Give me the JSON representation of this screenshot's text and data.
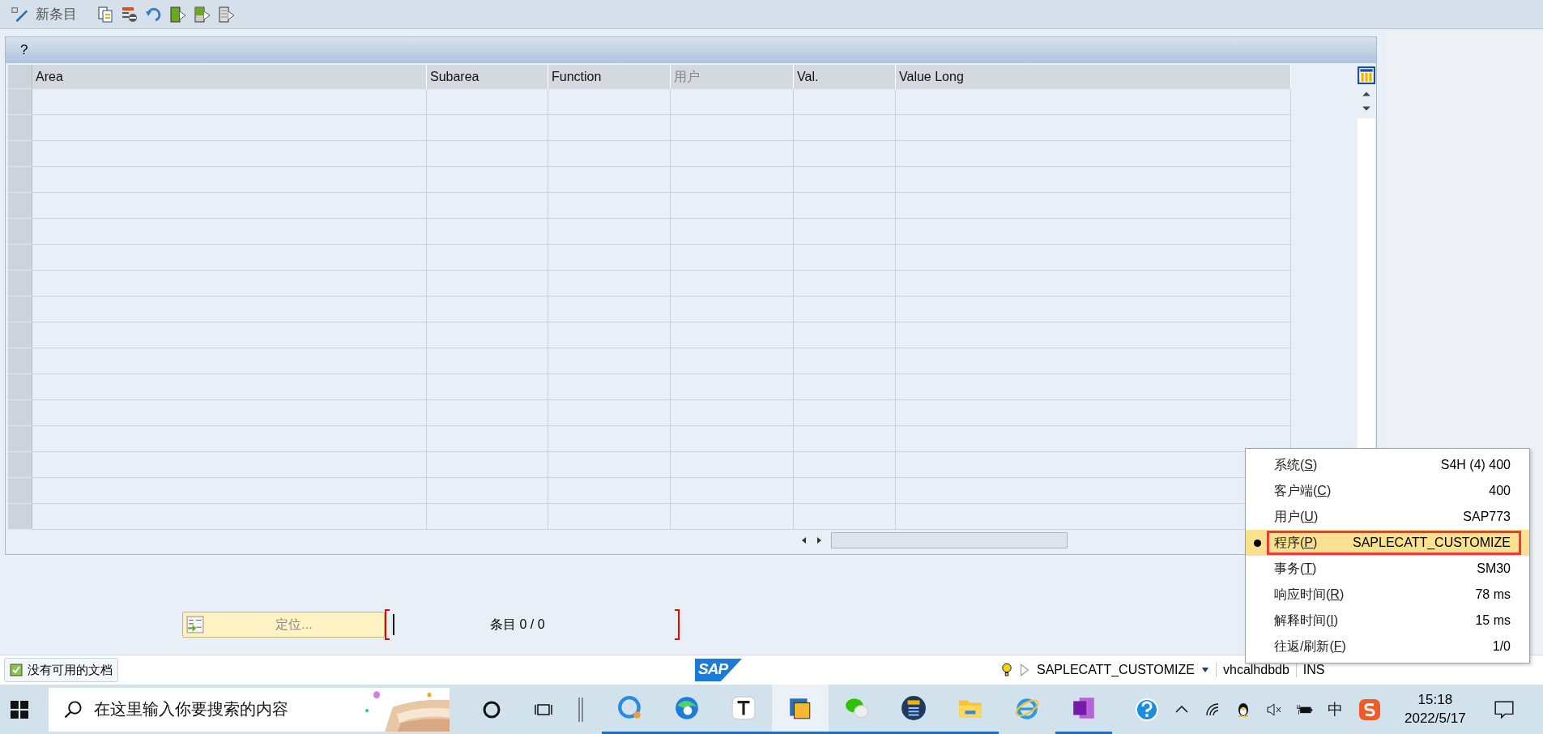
{
  "toolbar": {
    "new_entry_label": "新条目"
  },
  "panel": {
    "title": "?"
  },
  "table": {
    "columns": [
      {
        "label": "Area",
        "dim": false
      },
      {
        "label": "Subarea",
        "dim": false
      },
      {
        "label": "Function",
        "dim": false
      },
      {
        "label": "用户",
        "dim": true
      },
      {
        "label": "Val.",
        "dim": false
      },
      {
        "label": "Value Long",
        "dim": false
      }
    ]
  },
  "locate_button": {
    "label": "定位..."
  },
  "entries": {
    "label": "条目",
    "count": "0 / 0"
  },
  "status_bar": {
    "logo": "SAP",
    "message": "没有可用的文档",
    "program": "SAPLECATT_CUSTOMIZE",
    "server": "vhcalhdbdb",
    "mode": "INS"
  },
  "system_popup": {
    "items": [
      {
        "prefix": "系统(",
        "key": "S",
        "suffix": ")",
        "value": "S4H (4) 400",
        "selected": false,
        "outlined": false
      },
      {
        "prefix": "客户端(",
        "key": "C",
        "suffix": ")",
        "value": "400",
        "selected": false,
        "outlined": false
      },
      {
        "prefix": "用户(",
        "key": "U",
        "suffix": ")",
        "value": "SAP773",
        "selected": false,
        "outlined": false
      },
      {
        "prefix": "程序(",
        "key": "P",
        "suffix": ")",
        "value": "SAPLECATT_CUSTOMIZE",
        "selected": true,
        "outlined": true
      },
      {
        "prefix": "事务(",
        "key": "T",
        "suffix": ")",
        "value": "SM30",
        "selected": false,
        "outlined": false
      },
      {
        "prefix": "响应时间(",
        "key": "R",
        "suffix": ")",
        "value": "78 ms",
        "selected": false,
        "outlined": false
      },
      {
        "prefix": "解释时间(",
        "key": "I",
        "suffix": ")",
        "value": "15 ms",
        "selected": false,
        "outlined": false
      },
      {
        "prefix": "往返/刷新(",
        "key": "F",
        "suffix": ")",
        "value": "1/0",
        "selected": false,
        "outlined": false
      }
    ]
  },
  "taskbar": {
    "search_placeholder": "在这里输入你要搜索的内容",
    "apps": [
      {
        "kind": "chat",
        "running": true,
        "selected": false
      },
      {
        "kind": "edge",
        "running": true,
        "selected": false
      },
      {
        "kind": "typora",
        "running": true,
        "selected": false
      },
      {
        "kind": "sapgui",
        "running": true,
        "selected": true
      },
      {
        "kind": "wechat",
        "running": true,
        "selected": false
      },
      {
        "kind": "saplogon",
        "running": true,
        "selected": false
      },
      {
        "kind": "files",
        "running": true,
        "selected": false
      },
      {
        "kind": "ie",
        "running": false,
        "selected": false
      },
      {
        "kind": "onenote",
        "running": true,
        "selected": false
      }
    ],
    "ime": "中",
    "time": "15:18",
    "date": "2022/5/17"
  }
}
